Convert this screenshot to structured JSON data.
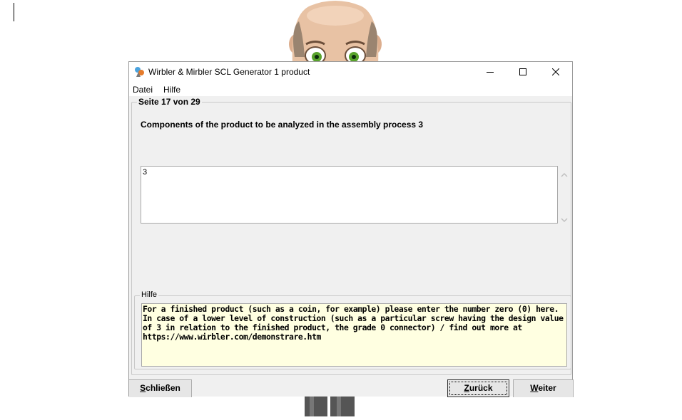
{
  "window": {
    "title": "Wirbler & Mirbler SCL Generator 1 product"
  },
  "menu": {
    "items": [
      "Datei",
      "Hilfe"
    ]
  },
  "page": {
    "indicator": "Seite 17 von 29",
    "question": "Components of the product to be analyzed in the assembly process 3",
    "answer_value": "3"
  },
  "help": {
    "legend": "Hilfe",
    "text": "For a finished product (such as a coin, for example) please enter the number zero (0) here. In case of a lower level of construction (such as a particular screw having the design value of 3 in relation to the finished product, the grade 0 connector) / find out more at https://www.wirbler.com/demonstrare.htm"
  },
  "buttons": {
    "close": {
      "accel": "S",
      "rest": "chließen"
    },
    "back": {
      "accel": "Z",
      "rest": "urück"
    },
    "next": {
      "accel": "W",
      "rest": "eiter"
    }
  },
  "colors": {
    "help_background": "#ffffe1",
    "window_background": "#f0f0f0"
  }
}
